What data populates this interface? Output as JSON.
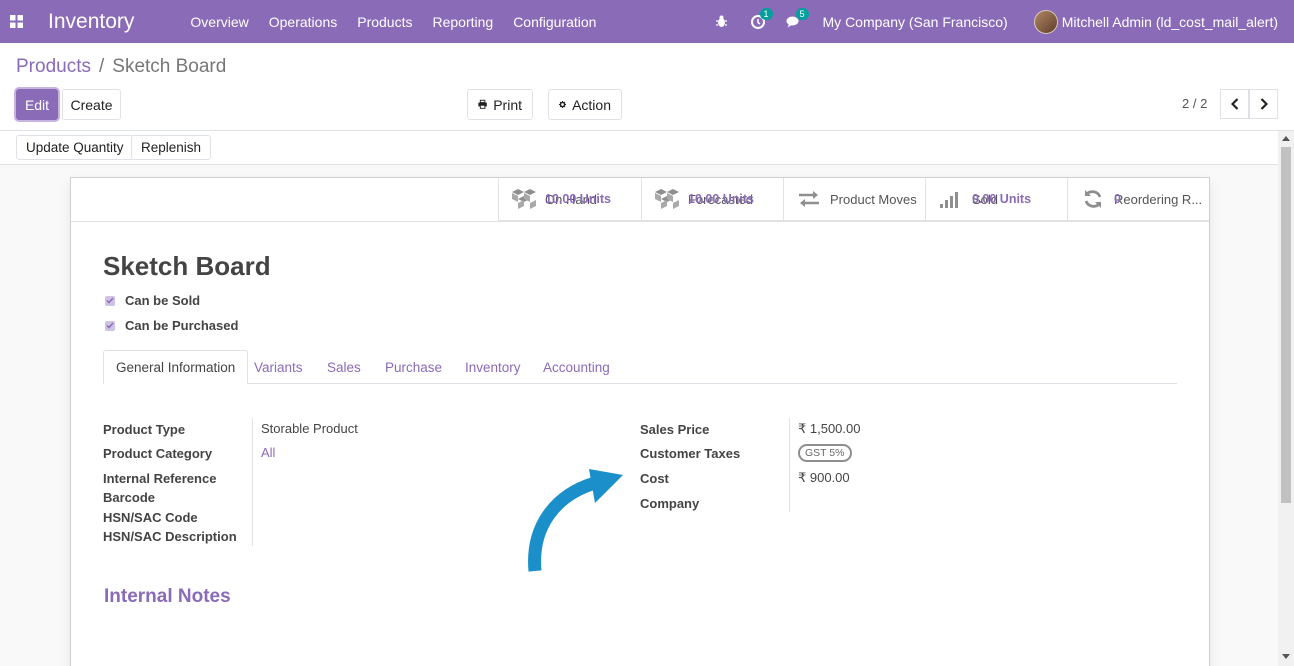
{
  "navbar": {
    "brand": "Inventory",
    "menu": [
      "Overview",
      "Operations",
      "Products",
      "Reporting",
      "Configuration"
    ],
    "activity_badge": "1",
    "messages_badge": "5",
    "company": "My Company (San Francisco)",
    "user": "Mitchell Admin (ld_cost_mail_alert)"
  },
  "breadcrumb": {
    "parent": "Products",
    "separator": "/",
    "current": "Sketch Board"
  },
  "toolbar": {
    "edit": "Edit",
    "create": "Create",
    "print": "Print",
    "action": "Action",
    "pager": "2 / 2"
  },
  "statusbar": {
    "update_quantity": "Update Quantity",
    "replenish": "Replenish"
  },
  "smart_buttons": [
    {
      "value": "10.00 Units",
      "label": "On Hand",
      "icon": "cubes-icon"
    },
    {
      "value": "10.00 Units",
      "label": "Forecasted",
      "icon": "cubes-icon"
    },
    {
      "value": "",
      "label": "Product Moves",
      "icon": "exchange-icon"
    },
    {
      "value": "0.00 Units",
      "label": "Sold",
      "icon": "signal-icon"
    },
    {
      "value": "0",
      "label": "Reordering R...",
      "icon": "refresh-icon"
    }
  ],
  "product": {
    "name": "Sketch Board",
    "can_be_sold": "Can be Sold",
    "can_be_purchased": "Can be Purchased"
  },
  "tabs": [
    "General Information",
    "Variants",
    "Sales",
    "Purchase",
    "Inventory",
    "Accounting"
  ],
  "fields_left": {
    "product_type_label": "Product Type",
    "product_type": "Storable Product",
    "product_category_label": "Product Category",
    "product_category": "All",
    "internal_reference_label": "Internal Reference",
    "barcode_label": "Barcode",
    "hsn_code_label": "HSN/SAC Code",
    "hsn_desc_label": "HSN/SAC Description"
  },
  "fields_right": {
    "sales_price_label": "Sales Price",
    "sales_price": "₹ 1,500.00",
    "customer_taxes_label": "Customer Taxes",
    "customer_taxes": "GST 5%",
    "cost_label": "Cost",
    "cost": "₹ 900.00",
    "company_label": "Company"
  },
  "notes_title": "Internal Notes",
  "colors": {
    "brand": "#8a6bb8",
    "badge": "#00a09d",
    "arrow": "#1a8fc9"
  }
}
